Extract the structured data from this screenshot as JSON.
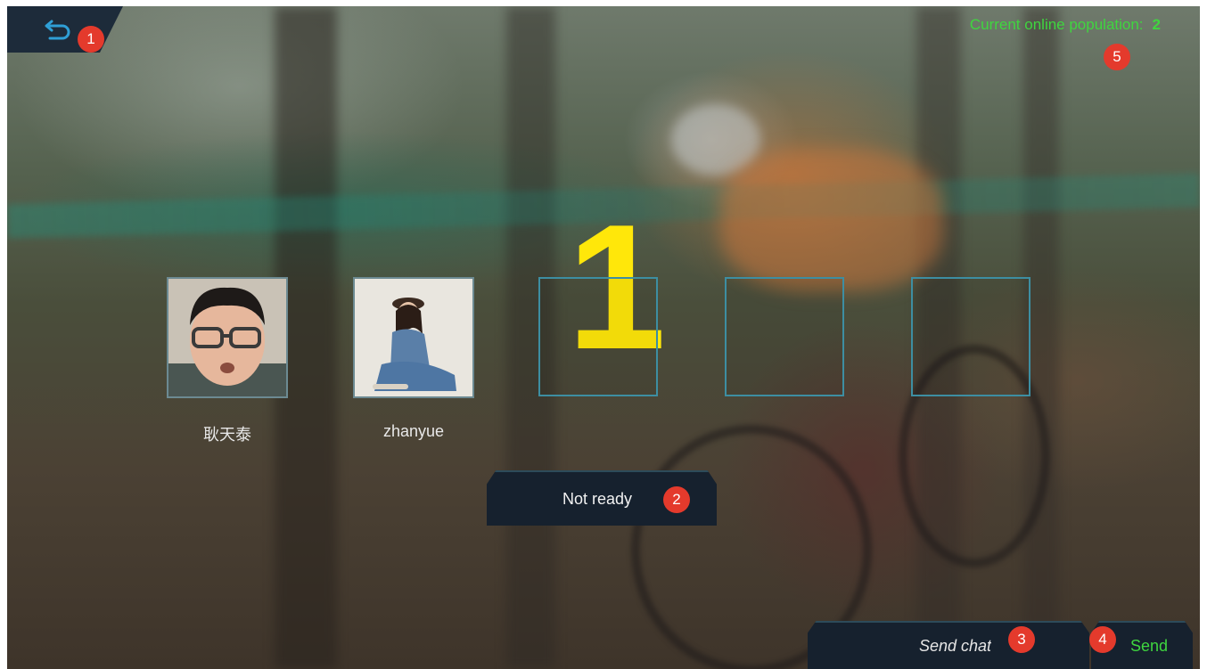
{
  "header": {
    "online_label": "Current online population:",
    "online_count": "2"
  },
  "countdown": "1",
  "players": [
    {
      "name": "耿天泰",
      "avatar_icon": "player-photo-man"
    },
    {
      "name": "zhanyue",
      "avatar_icon": "player-photo-woman"
    }
  ],
  "empty_slots": 3,
  "ready_button": {
    "label": "Not ready"
  },
  "chat": {
    "placeholder": "Send chat",
    "send_label": "Send"
  },
  "badges": [
    "1",
    "2",
    "3",
    "4",
    "5"
  ],
  "colors": {
    "accent_green": "#3fd63f",
    "countdown_yellow": "#ffe70a",
    "button_bg": "#16212e",
    "badge_red": "#e43a2c",
    "slot_border": "#3d8ea2"
  }
}
